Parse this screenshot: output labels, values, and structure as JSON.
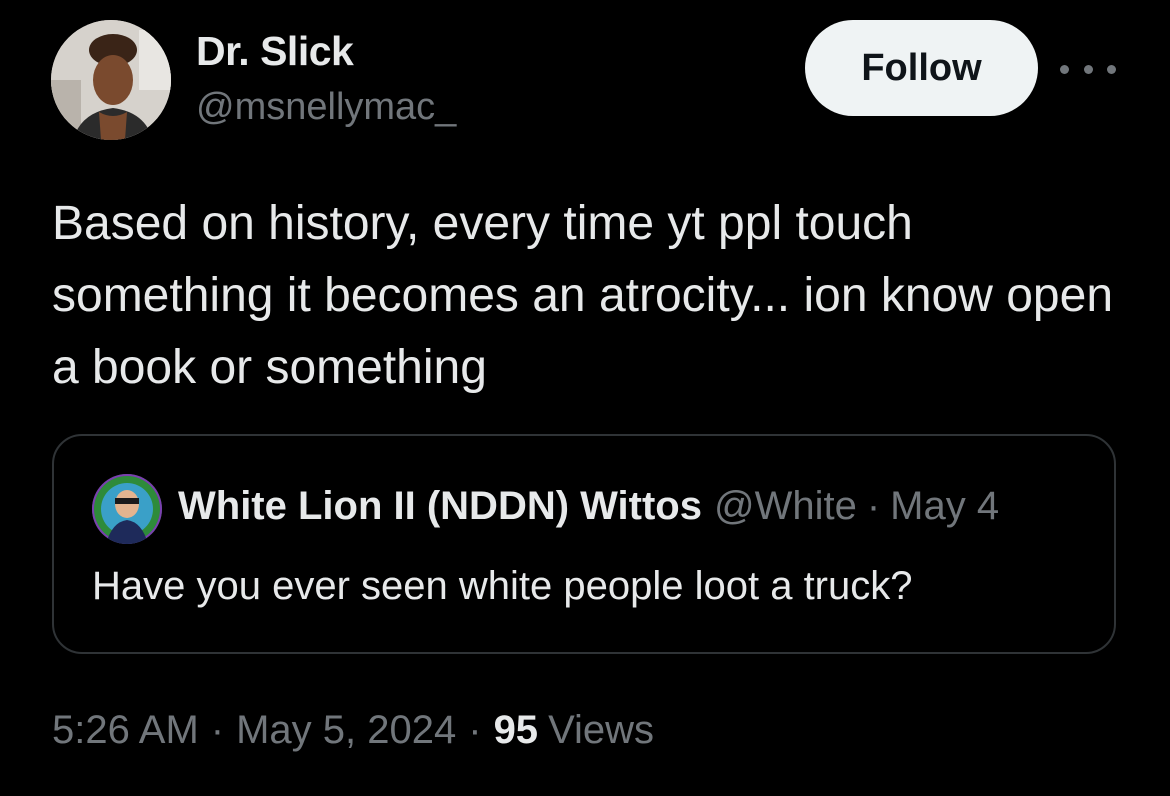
{
  "author": {
    "name": "Dr. Slick",
    "handle": "@msnellymac_"
  },
  "actions": {
    "follow_label": "Follow",
    "more_icon": "more-horizontal-icon"
  },
  "tweet": {
    "text": "Based on history, every time yt ppl touch something it becomes an atrocity... ion know open a book or something"
  },
  "quoted_tweet": {
    "author_name": "White Lion II (NDDN) Wittos",
    "author_handle": "@White",
    "separator": "·",
    "date": "May 4",
    "text": "Have you ever seen white people loot a truck?"
  },
  "meta": {
    "time": "5:26 AM",
    "date": "May 5, 2024",
    "separator": "·",
    "views_count": "95",
    "views_label": "Views"
  },
  "colors": {
    "background": "#000000",
    "primary_text": "#e7e9ea",
    "secondary_text": "#71767b",
    "border": "#2f3336",
    "follow_bg": "#eff3f4"
  }
}
